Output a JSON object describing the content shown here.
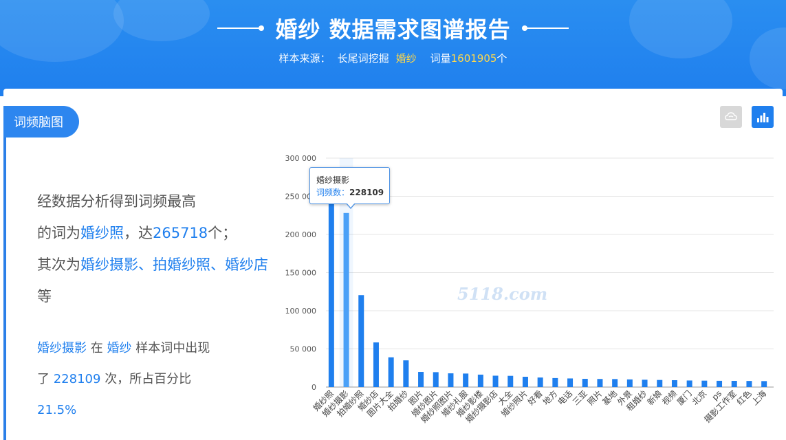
{
  "banner": {
    "title": "婚纱 数据需求图谱报告",
    "source_label": "样本来源：",
    "source_value": "长尾词挖掘",
    "keyword": "婚纱",
    "count_label": "词量",
    "count_value": "1601905",
    "count_unit": "个"
  },
  "section": {
    "tab_label": "词频脑图"
  },
  "summary": {
    "line1": "经数据分析得到词频最高",
    "line2_prefix": "的词为",
    "top_word": "婚纱照",
    "line2_mid": "，达",
    "top_count": "265718",
    "line2_suffix": "个；",
    "line3_prefix": "其次为",
    "next_words": "婚纱摄影、拍婚纱照、婚纱店",
    "line3_suffix": "等"
  },
  "detail": {
    "word": "婚纱摄影",
    "in_text": "在",
    "keyword": "婚纱",
    "sample_text": "样本词中出现",
    "le": "了",
    "count": "228109",
    "times_text": "次，所占百分比",
    "percent": "21.5%"
  },
  "tooltip": {
    "title": "婚纱摄影",
    "label": "词频数：",
    "value": "228109"
  },
  "watermark": "5118.com",
  "colors": {
    "bar": "#1f7fee",
    "bar_highlight": "#4aa0f7",
    "banner": "#1f7fee",
    "accent_text": "#ffd84a"
  },
  "icons": {
    "cloud_view": "cloud-icon",
    "bar_view": "bar-chart-icon"
  },
  "chart_data": {
    "type": "bar",
    "categories": [
      "婚纱照",
      "婚纱摄影",
      "拍婚纱照",
      "婚纱店",
      "图片大全",
      "拍婚纱",
      "图片",
      "婚纱图片",
      "婚纱照图片",
      "婚纱礼服",
      "婚纱影楼",
      "婚纱摄影店",
      "大全",
      "婚纱照片",
      "好看",
      "地方",
      "电话",
      "三亚",
      "照片",
      "基地",
      "外景",
      "租婚纱",
      "新娘",
      "视频",
      "厦门",
      "北京",
      "ps",
      "摄影工作室",
      "红色",
      "上海"
    ],
    "values": [
      265718,
      228109,
      120500,
      58500,
      39000,
      35000,
      19800,
      19500,
      18000,
      17700,
      16300,
      14900,
      14700,
      13500,
      12500,
      11800,
      11300,
      10800,
      10600,
      10500,
      10000,
      9600,
      9300,
      9000,
      8600,
      8400,
      8200,
      8100,
      8000,
      7800
    ],
    "yticks": [
      "0",
      "50 000",
      "100 000",
      "150 000",
      "200 000",
      "250 000",
      "300 000"
    ],
    "ylim": [
      0,
      300000
    ],
    "highlight_index": 1,
    "grid": true
  }
}
